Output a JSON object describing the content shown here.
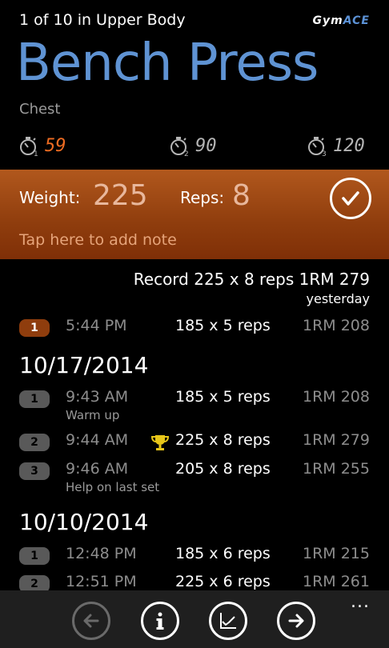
{
  "header": {
    "position_text": "1 of 10 in Upper Body",
    "logo_gym": "Gym",
    "logo_ace": "ACE"
  },
  "exercise": {
    "name": "Bench Press",
    "muscle": "Chest"
  },
  "timers": [
    {
      "index": "1",
      "value": "59",
      "active": true,
      "icon": "stopwatch-1-icon"
    },
    {
      "index": "2",
      "value": "90",
      "active": false,
      "icon": "stopwatch-2-icon"
    },
    {
      "index": "3",
      "value": "120",
      "active": false,
      "icon": "stopwatch-3-icon"
    }
  ],
  "entry": {
    "weight_label": "Weight:",
    "weight_value": "225",
    "reps_label": "Reps:",
    "reps_value": "8",
    "note_placeholder": "Tap here to add note",
    "confirm_icon": "checkmark-icon"
  },
  "record": {
    "text": "Record 225 x 8 reps 1RM 279",
    "when": "yesterday"
  },
  "today_sets": [
    {
      "num": "1",
      "time": "5:44 PM",
      "reps": "185 x 5 reps",
      "rm": "1RM 208"
    }
  ],
  "history": [
    {
      "date": "10/17/2014",
      "sets": [
        {
          "num": "1",
          "time": "9:43 AM",
          "reps": "185 x 5 reps",
          "rm": "1RM 208",
          "note": "Warm up"
        },
        {
          "num": "2",
          "time": "9:44 AM",
          "reps": "225 x 8 reps",
          "rm": "1RM 279",
          "trophy": true
        },
        {
          "num": "3",
          "time": "9:46 AM",
          "reps": "205 x 8 reps",
          "rm": "1RM 255",
          "note": "Help on last set"
        }
      ]
    },
    {
      "date": "10/10/2014",
      "sets": [
        {
          "num": "1",
          "time": "12:48 PM",
          "reps": "185 x 6 reps",
          "rm": "1RM 215"
        },
        {
          "num": "2",
          "time": "12:51 PM",
          "reps": "225 x 6 reps",
          "rm": "1RM 261"
        }
      ]
    }
  ],
  "app_bar": {
    "buttons": [
      "back-arrow-icon",
      "info-icon",
      "chart-icon",
      "forward-arrow-icon"
    ],
    "more": "..."
  },
  "colors": {
    "accent_blue": "#5f93d3",
    "accent_orange": "#ef6c22",
    "band": "#8f3d0d"
  }
}
